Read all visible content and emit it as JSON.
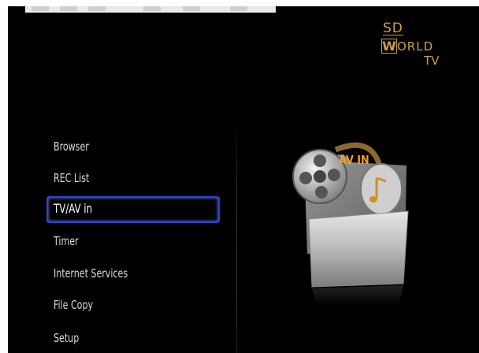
{
  "logo": {
    "line1": "SD",
    "letter_w": "W",
    "line2_rest": "ORLD",
    "line3": "TV"
  },
  "menu": {
    "items": [
      {
        "label": "Browser",
        "selected": false
      },
      {
        "label": "REC  List",
        "selected": false
      },
      {
        "label": "TV/AV in",
        "selected": true
      },
      {
        "label": "Timer",
        "selected": false
      },
      {
        "label": "Internet Services",
        "selected": false
      },
      {
        "label": "File Copy",
        "selected": false
      },
      {
        "label": "Setup",
        "selected": false
      }
    ]
  },
  "preview": {
    "label": "AV IN"
  },
  "colors": {
    "background": "#000000",
    "focus": "#2b45d8",
    "logo": "#c9a248",
    "av_label": "#ff9a1a",
    "menu_text": "#d8d8d8"
  }
}
